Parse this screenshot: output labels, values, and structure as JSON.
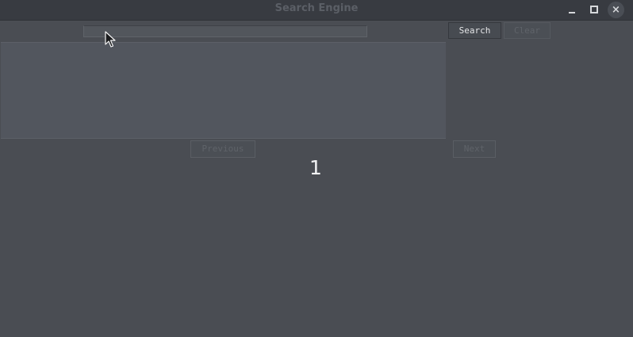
{
  "window": {
    "title": "Search Engine",
    "controls": {
      "minimize": "minimize",
      "maximize": "maximize",
      "close": "×"
    }
  },
  "search": {
    "value": "",
    "placeholder": "",
    "search_label": "Search",
    "clear_label": "Clear"
  },
  "results": {
    "items": []
  },
  "pagination": {
    "previous_label": "Previous",
    "next_label": "Next",
    "page_number": "1"
  },
  "icons": {
    "minimize": "minimize-icon",
    "maximize": "maximize-icon",
    "close": "close-icon",
    "cursor": "mouse-pointer-icon"
  },
  "colors": {
    "background": "#4a4d53",
    "titlebar": "#383b41",
    "results_area": "#52565e",
    "text_primary": "#f2f3f4",
    "text_disabled": "#5f6369"
  }
}
